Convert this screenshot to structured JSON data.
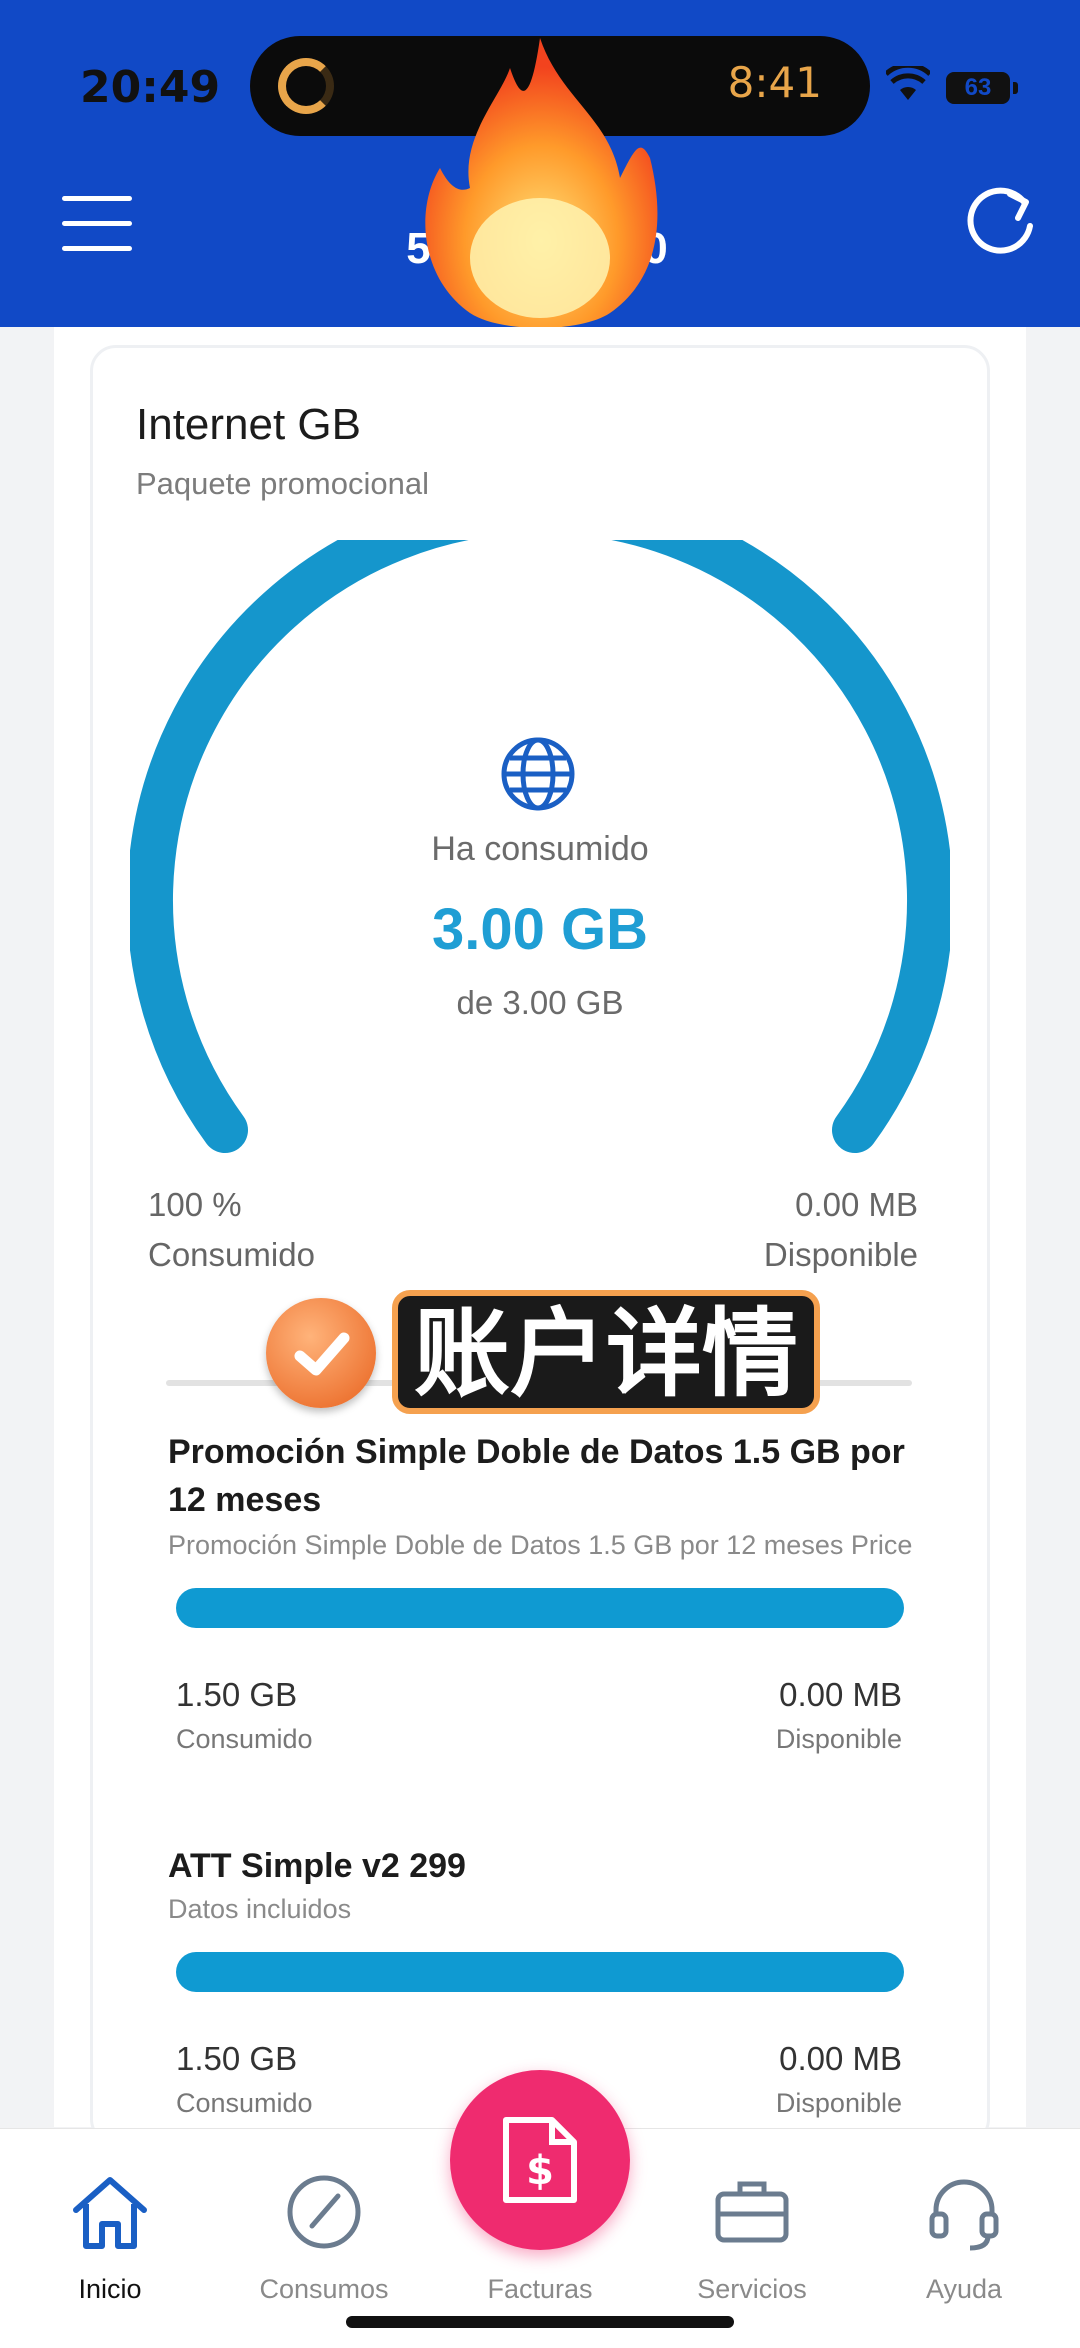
{
  "status_bar": {
    "time": "20:49",
    "island_time": "8:41",
    "battery": "63"
  },
  "header": {
    "number_partial": "5",
    "number_suffix": "0"
  },
  "card": {
    "title": "Internet GB",
    "subtitle": "Paquete promocional",
    "gauge": {
      "label": "Ha consumido",
      "value": "3.00 GB",
      "total": "de 3.00 GB",
      "consumed_fraction": 1.0,
      "left_value": "100 %",
      "left_label": "Consumido",
      "right_value": "0.00 MB",
      "right_label": "Disponible"
    }
  },
  "overlay": {
    "caption": "账户详情"
  },
  "plans": [
    {
      "title": "Promoción Simple Doble de Datos 1.5 GB por 12 meses",
      "desc": "Promoción Simple Doble de Datos 1.5 GB por 12 meses Price",
      "used": "1.50 GB",
      "used_label": "Consumido",
      "available": "0.00 MB",
      "available_label": "Disponible",
      "consumed_fraction": 1.0
    },
    {
      "title": "ATT Simple v2 299",
      "desc": "Datos incluidos",
      "used": "1.50 GB",
      "used_label": "Consumido",
      "available": "0.00 MB",
      "available_label": "Disponible",
      "consumed_fraction": 1.0
    }
  ],
  "bottom_nav": {
    "items": [
      {
        "label": "Inicio",
        "icon": "home-icon",
        "active": true
      },
      {
        "label": "Consumos",
        "icon": "gauge-icon"
      },
      {
        "label": "Facturas",
        "icon": "invoice-dollar-icon"
      },
      {
        "label": "Servicios",
        "icon": "briefcase-icon"
      },
      {
        "label": "Ayuda",
        "icon": "headset-icon"
      }
    ]
  },
  "colors": {
    "header_blue": "#1149c6",
    "accent_blue": "#0f9ad2",
    "fab_pink": "#ef2b6f"
  }
}
